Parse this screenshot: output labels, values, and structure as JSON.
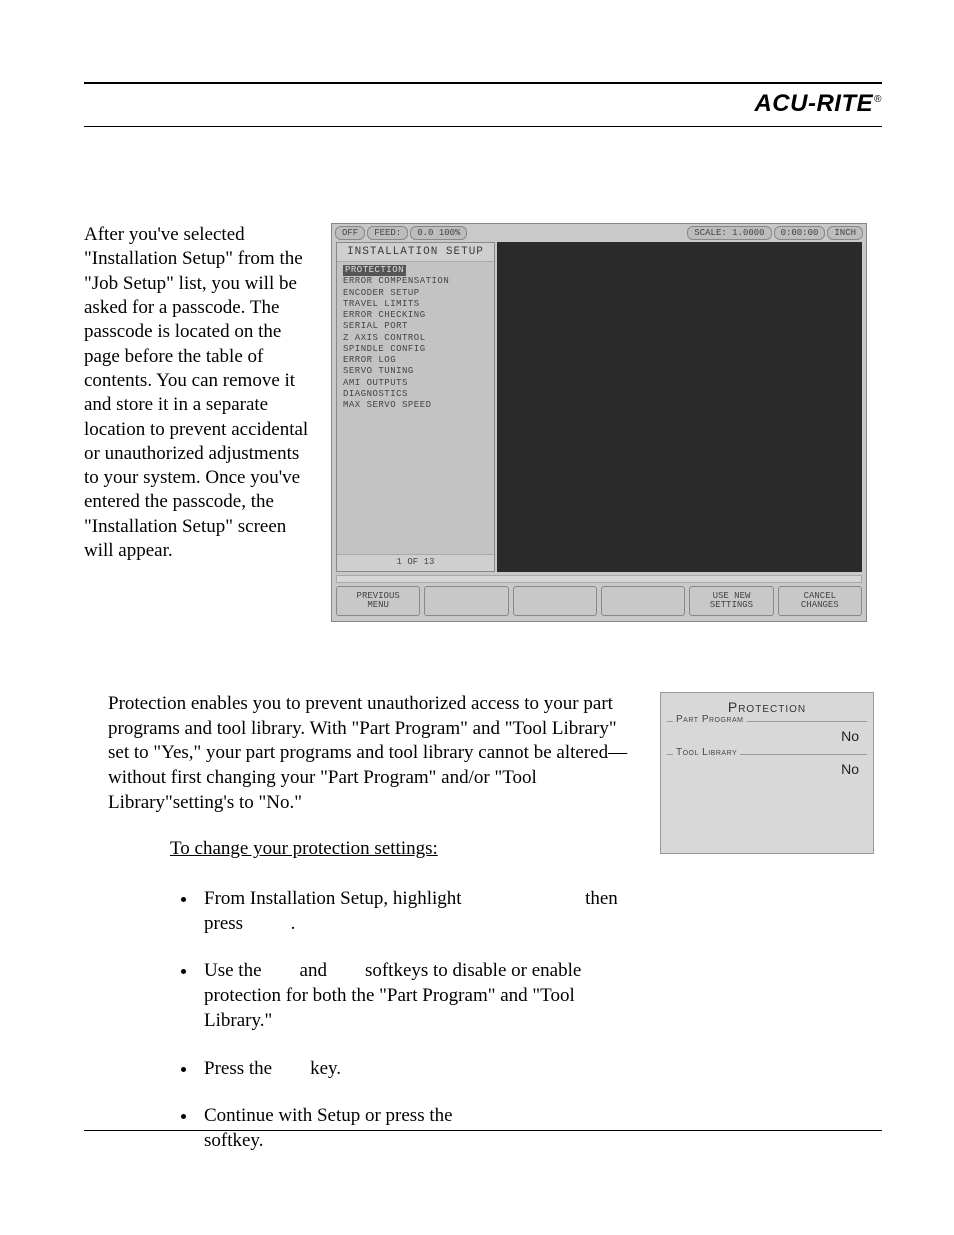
{
  "header": {
    "brand": "ACU-RITE",
    "tm": "®"
  },
  "intro": "After you've selected \"Installation Setup\" from the \"Job Setup\" list, you will be asked for a passcode. The passcode is located on the page before the table of contents. You can remove it and store it in a separate location to prevent accidental or unauthorized adjustments to your system. Once you've entered the passcode, the \"Installation Setup\" screen will appear.",
  "shot1": {
    "top_left": [
      "OFF",
      "FEED:",
      "0.0 100%"
    ],
    "top_right": [
      "SCALE: 1.0000",
      "0:00:00",
      "INCH"
    ],
    "menu_title": "INSTALLATION SETUP",
    "items": [
      "Protection",
      "Error Compensation",
      "Encoder Setup",
      "Travel Limits",
      "Error Checking",
      "Serial Port",
      "Z Axis Control",
      "Spindle Config",
      "Error Log",
      "Servo Tuning",
      "AMI Outputs",
      "Diagnostics",
      "Max Servo Speed"
    ],
    "footer": "1 OF 13",
    "softkeys": [
      "PREVIOUS\nMENU",
      "",
      "",
      "",
      "USE NEW\nSETTINGS",
      "CANCEL\nCHANGES"
    ]
  },
  "prot_para": "Protection enables you to prevent unauthorized access to your part programs and tool library. With \"Part Program\" and \"Tool Library\" set to \"Yes,\" your part programs and tool library cannot be altered—without first changing your \"Part Program\" and/or \"Tool Library\"setting's to \"No.\"",
  "prot_sub": "To change your protection settings:",
  "bullets": {
    "b1a": "From Installation Setup, highlight ",
    "b1b": " then press ",
    "b1c": ".",
    "b2a": "Use the ",
    "b2b": " and ",
    "b2c": " softkeys to disable or enable protection for both the \"Part Program\" and \"Tool Library.\"",
    "b3a": "Press the ",
    "b3b": " key.",
    "b4a": "Continue with Setup or press the ",
    "b4b": " softkey."
  },
  "prot_shot": {
    "title": "Protection",
    "fields": [
      {
        "label": "Part Program",
        "value": "No"
      },
      {
        "label": "Tool Library",
        "value": "No"
      }
    ]
  }
}
